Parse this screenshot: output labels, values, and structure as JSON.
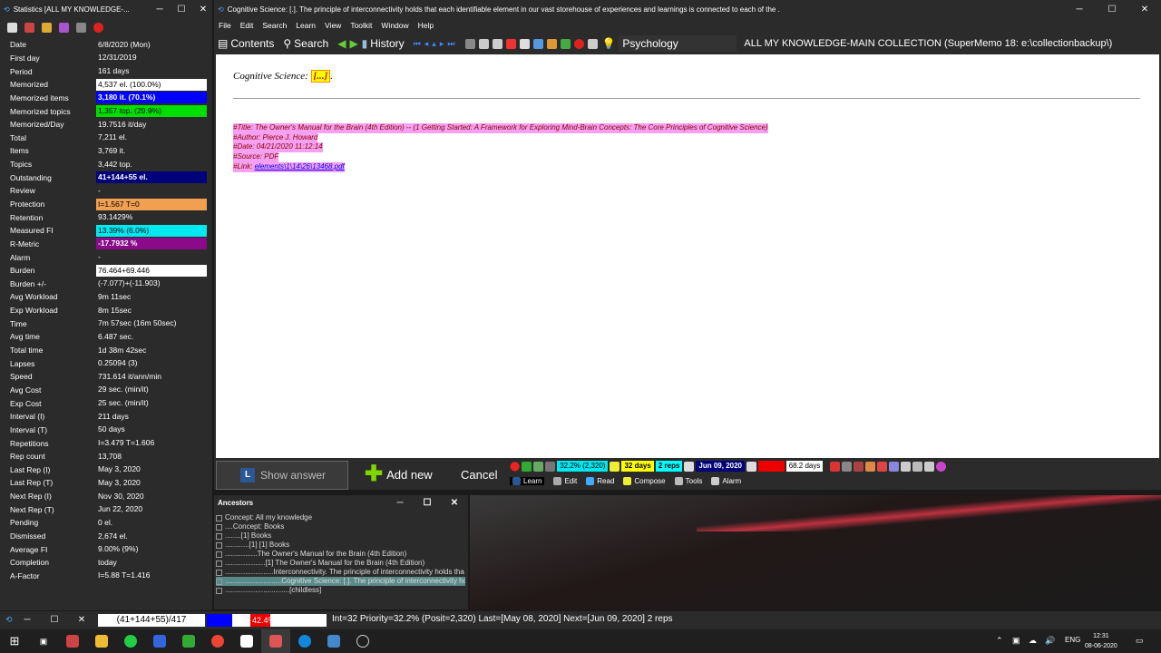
{
  "stats_window": {
    "title": "Statistics [ALL MY KNOWLEDGE-...",
    "minimize": "─",
    "maximize": "☐",
    "close": "✕",
    "rows": [
      {
        "label": "Date",
        "value": "6/8/2020 (Mon)",
        "bg": "",
        "fg": ""
      },
      {
        "label": "First day",
        "value": "12/31/2019",
        "bg": "",
        "fg": ""
      },
      {
        "label": "Period",
        "value": "161 days",
        "bg": "",
        "fg": ""
      },
      {
        "label": "Memorized",
        "value": "4,537 el. (100.0%)",
        "bg": "#ffffff",
        "fg": "#000000"
      },
      {
        "label": "Memorized items",
        "value": "3,180 it. (70.1%)",
        "bg": "#0000ff",
        "fg": "#ffffff"
      },
      {
        "label": "Memorized topics",
        "value": "1,357 top. (29.9%)",
        "bg": "#00e000",
        "fg": "#000000"
      },
      {
        "label": "Memorized/Day",
        "value": "19.7516 it/day",
        "bg": "",
        "fg": ""
      },
      {
        "label": "Total",
        "value": "7,211 el.",
        "bg": "",
        "fg": ""
      },
      {
        "label": "Items",
        "value": "3,769 it.",
        "bg": "",
        "fg": ""
      },
      {
        "label": "Topics",
        "value": "3,442 top.",
        "bg": "",
        "fg": ""
      },
      {
        "label": "Outstanding",
        "value": "41+144+55 el.",
        "bg": "#00007a",
        "fg": "#ffffff"
      },
      {
        "label": "Review",
        "value": "-",
        "bg": "",
        "fg": ""
      },
      {
        "label": "Protection",
        "value": "I=1.567 T=0",
        "bg": "#f0a050",
        "fg": "#000000"
      },
      {
        "label": "Retention",
        "value": "93.1429%",
        "bg": "",
        "fg": ""
      },
      {
        "label": "Measured FI",
        "value": "13.39% (6.0%)",
        "bg": "#00e8f0",
        "fg": "#000000"
      },
      {
        "label": "R-Metric",
        "value": "-17.7932 %",
        "bg": "#8a0a8a",
        "fg": "#ffffff"
      },
      {
        "label": "Alarm",
        "value": "-",
        "bg": "",
        "fg": ""
      },
      {
        "label": "Burden",
        "value": "76.464+69.446",
        "bg": "#ffffff",
        "fg": "#000000"
      },
      {
        "label": "Burden +/-",
        "value": "(-7.077)+(-11.903)",
        "bg": "",
        "fg": ""
      },
      {
        "label": "Avg Workload",
        "value": "9m 11sec",
        "bg": "",
        "fg": ""
      },
      {
        "label": "Exp Workload",
        "value": "8m 15sec",
        "bg": "",
        "fg": ""
      },
      {
        "label": "Time",
        "value": "7m 57sec (16m 50sec)",
        "bg": "",
        "fg": ""
      },
      {
        "label": "Avg time",
        "value": "6.487 sec.",
        "bg": "",
        "fg": ""
      },
      {
        "label": "Total time",
        "value": "1d 38m 42sec",
        "bg": "",
        "fg": ""
      },
      {
        "label": "Lapses",
        "value": "0.25094 (3)",
        "bg": "",
        "fg": ""
      },
      {
        "label": "Speed",
        "value": "731.614 it/ann/min",
        "bg": "",
        "fg": ""
      },
      {
        "label": "Avg Cost",
        "value": "29 sec. (min/it)",
        "bg": "",
        "fg": ""
      },
      {
        "label": "Exp Cost",
        "value": "25 sec. (min/it)",
        "bg": "",
        "fg": ""
      },
      {
        "label": "Interval (I)",
        "value": "211 days",
        "bg": "",
        "fg": ""
      },
      {
        "label": "Interval (T)",
        "value": "50 days",
        "bg": "",
        "fg": ""
      },
      {
        "label": "Repetitions",
        "value": "I=3.479 T=1.606",
        "bg": "",
        "fg": ""
      },
      {
        "label": "Rep count",
        "value": "13,708",
        "bg": "",
        "fg": ""
      },
      {
        "label": "Last Rep (I)",
        "value": "May 3, 2020",
        "bg": "",
        "fg": ""
      },
      {
        "label": "Last Rep (T)",
        "value": "May 3, 2020",
        "bg": "",
        "fg": ""
      },
      {
        "label": "Next Rep (I)",
        "value": "Nov 30, 2020",
        "bg": "",
        "fg": ""
      },
      {
        "label": "Next Rep (T)",
        "value": "Jun 22, 2020",
        "bg": "",
        "fg": ""
      },
      {
        "label": "Pending",
        "value": "0 el.",
        "bg": "",
        "fg": ""
      },
      {
        "label": "Dismissed",
        "value": "2,674 el.",
        "bg": "",
        "fg": ""
      },
      {
        "label": "Average FI",
        "value": "9.00% (9%)",
        "bg": "",
        "fg": ""
      },
      {
        "label": "Completion",
        "value": "today",
        "bg": "",
        "fg": ""
      },
      {
        "label": "A-Factor",
        "value": "I=5.88 T=1.416",
        "bg": "",
        "fg": ""
      }
    ]
  },
  "main_window": {
    "title": "Cognitive Science: [.]. The principle of interconnectivity holds that each identifiable element in our vast storehouse of experiences and learnings is connected to each of the .",
    "menu": [
      "File",
      "Edit",
      "Search",
      "Learn",
      "View",
      "Toolkit",
      "Window",
      "Help"
    ],
    "toolbar": {
      "contents": "Contents",
      "search": "Search",
      "history": "History",
      "topic": "Psychology",
      "collection": "ALL MY KNOWLEDGE-MAIN COLLECTION (SuperMemo 18: e:\\collectionbackup\\)"
    },
    "question_prefix": "Cognitive Science:",
    "cloze": "[...]",
    "question_suffix": ".",
    "reference": {
      "title": "#Title: The Owner's Manual for the Brain (4th Edition) -- (1 Getting Started: A Framework for Exploring Mind-Brain Concepts: The Core Principles of Cognitive Science)",
      "author": "#Author: Pierce J. Howard",
      "date": "#Date: 04/21/2020 11:12:14",
      "source": "#Source: PDF",
      "link_label": "#Link:",
      "link": "elements\\1\\14\\26\\13468.pdf"
    }
  },
  "learnbar": {
    "show_answer": "Show answer",
    "add_new": "Add new",
    "cancel": "Cancel",
    "priority": "32.2% (2,320)",
    "days": "32 days",
    "reps": "2 reps",
    "date": "Jun 09, 2020",
    "red_value": "99.9%",
    "days2": "68.2 days",
    "modes": [
      "Learn",
      "Edit",
      "Read",
      "Compose",
      "Tools",
      "Alarm"
    ]
  },
  "ancestors": {
    "title": "Ancestors",
    "items": [
      "Concept: All my knowledge",
      "....Concept: Books",
      "........[1] Books",
      "............[1] [1] Books",
      "................The Owner's Manual for the Brain (4th Edition)",
      "....................[1] The Owner's Manual for the Brain (4th Edition)",
      "........................Interconnectivity.  The principle of interconnectivity holds tha",
      "............................Cognitive Science: [.]. The principle of interconnectivity ho",
      "................................[childless]"
    ]
  },
  "bottom_bar": {
    "counter": "(41+144+55)/417",
    "progress_pct": 42.4,
    "progress_label": "42.4%",
    "status": "Int=32 Priority=32.2% (Posit=2,320) Last=[May 08, 2020] Next=[Jun 09, 2020] 2 reps"
  },
  "taskbar": {
    "lang": "ENG",
    "time": "12:31",
    "date": "08-06-2020"
  },
  "colors": {
    "window_bg": "#2b2b2b",
    "accent_blue": "#0000ff"
  }
}
